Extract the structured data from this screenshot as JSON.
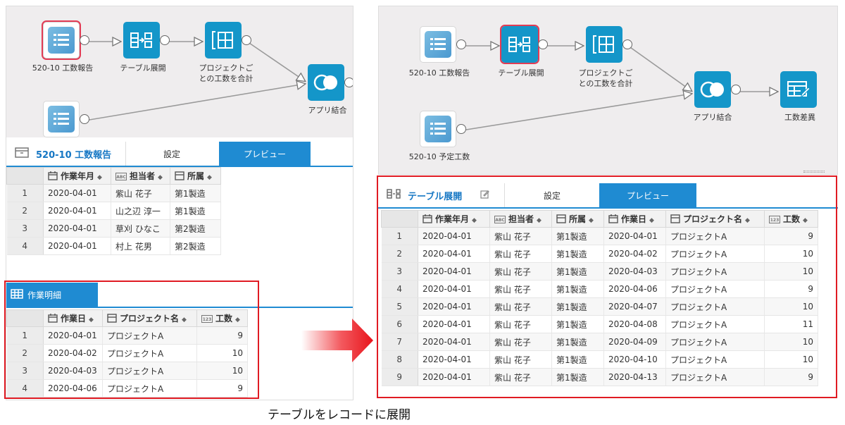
{
  "left": {
    "nodes": {
      "src1": "520-10 工数報告",
      "expand": "テーブル展開",
      "sum": "プロジェクトご\nとの工数を合計",
      "join": "アプリ結合"
    },
    "tabs": {
      "title": "520-10 工数報告",
      "settings": "設定",
      "preview": "プレビュー"
    },
    "table1": {
      "columns": [
        "作業年月",
        "担当者",
        "所属"
      ],
      "rows": [
        [
          "1",
          "2020-04-01",
          "紫山 花子",
          "第1製造"
        ],
        [
          "2",
          "2020-04-01",
          "山之辺 淳一",
          "第1製造"
        ],
        [
          "3",
          "2020-04-01",
          "草刈 ひなこ",
          "第2製造"
        ],
        [
          "4",
          "2020-04-01",
          "村上 花男",
          "第2製造"
        ]
      ]
    },
    "subtable": {
      "title": "作業明細",
      "columns": [
        "作業日",
        "プロジェクト名",
        "工数"
      ],
      "rows": [
        [
          "1",
          "2020-04-01",
          "プロジェクトA",
          "9"
        ],
        [
          "2",
          "2020-04-02",
          "プロジェクトA",
          "10"
        ],
        [
          "3",
          "2020-04-03",
          "プロジェクトA",
          "10"
        ],
        [
          "4",
          "2020-04-06",
          "プロジェクトA",
          "9"
        ]
      ]
    }
  },
  "right": {
    "nodes": {
      "src1": "520-10 工数報告",
      "expand": "テーブル展開",
      "sum": "プロジェクトご\nとの工数を合計",
      "join": "アプリ結合",
      "diff": "工数差異",
      "src2": "520-10 予定工数"
    },
    "tabs": {
      "title": "テーブル展開",
      "settings": "設定",
      "preview": "プレビュー"
    },
    "table": {
      "columns": [
        "作業年月",
        "担当者",
        "所属",
        "作業日",
        "プロジェクト名",
        "工数"
      ],
      "rows": [
        [
          "1",
          "2020-04-01",
          "紫山 花子",
          "第1製造",
          "2020-04-01",
          "プロジェクトA",
          "9"
        ],
        [
          "2",
          "2020-04-01",
          "紫山 花子",
          "第1製造",
          "2020-04-02",
          "プロジェクトA",
          "10"
        ],
        [
          "3",
          "2020-04-01",
          "紫山 花子",
          "第1製造",
          "2020-04-03",
          "プロジェクトA",
          "10"
        ],
        [
          "4",
          "2020-04-01",
          "紫山 花子",
          "第1製造",
          "2020-04-06",
          "プロジェクトA",
          "9"
        ],
        [
          "5",
          "2020-04-01",
          "紫山 花子",
          "第1製造",
          "2020-04-07",
          "プロジェクトA",
          "10"
        ],
        [
          "6",
          "2020-04-01",
          "紫山 花子",
          "第1製造",
          "2020-04-08",
          "プロジェクトA",
          "11"
        ],
        [
          "7",
          "2020-04-01",
          "紫山 花子",
          "第1製造",
          "2020-04-09",
          "プロジェクトA",
          "10"
        ],
        [
          "8",
          "2020-04-01",
          "紫山 花子",
          "第1製造",
          "2020-04-10",
          "プロジェクトA",
          "10"
        ],
        [
          "9",
          "2020-04-01",
          "紫山 花子",
          "第1製造",
          "2020-04-13",
          "プロジェクトA",
          "9"
        ]
      ]
    }
  },
  "icons": {
    "app": "app-list-icon",
    "expand": "table-expand-icon",
    "sum": "table-group-icon",
    "join": "join-circles-icon",
    "diff": "table-edit-icon",
    "calendar": "calendar-icon",
    "text": "abc-text-icon",
    "select": "dropdown-field-icon",
    "number": "number-123-icon"
  },
  "colors": {
    "accent": "#1f8bd2",
    "node": "#1496c9",
    "highlight": "#e01b23"
  },
  "caption": "テーブルをレコードに展開"
}
